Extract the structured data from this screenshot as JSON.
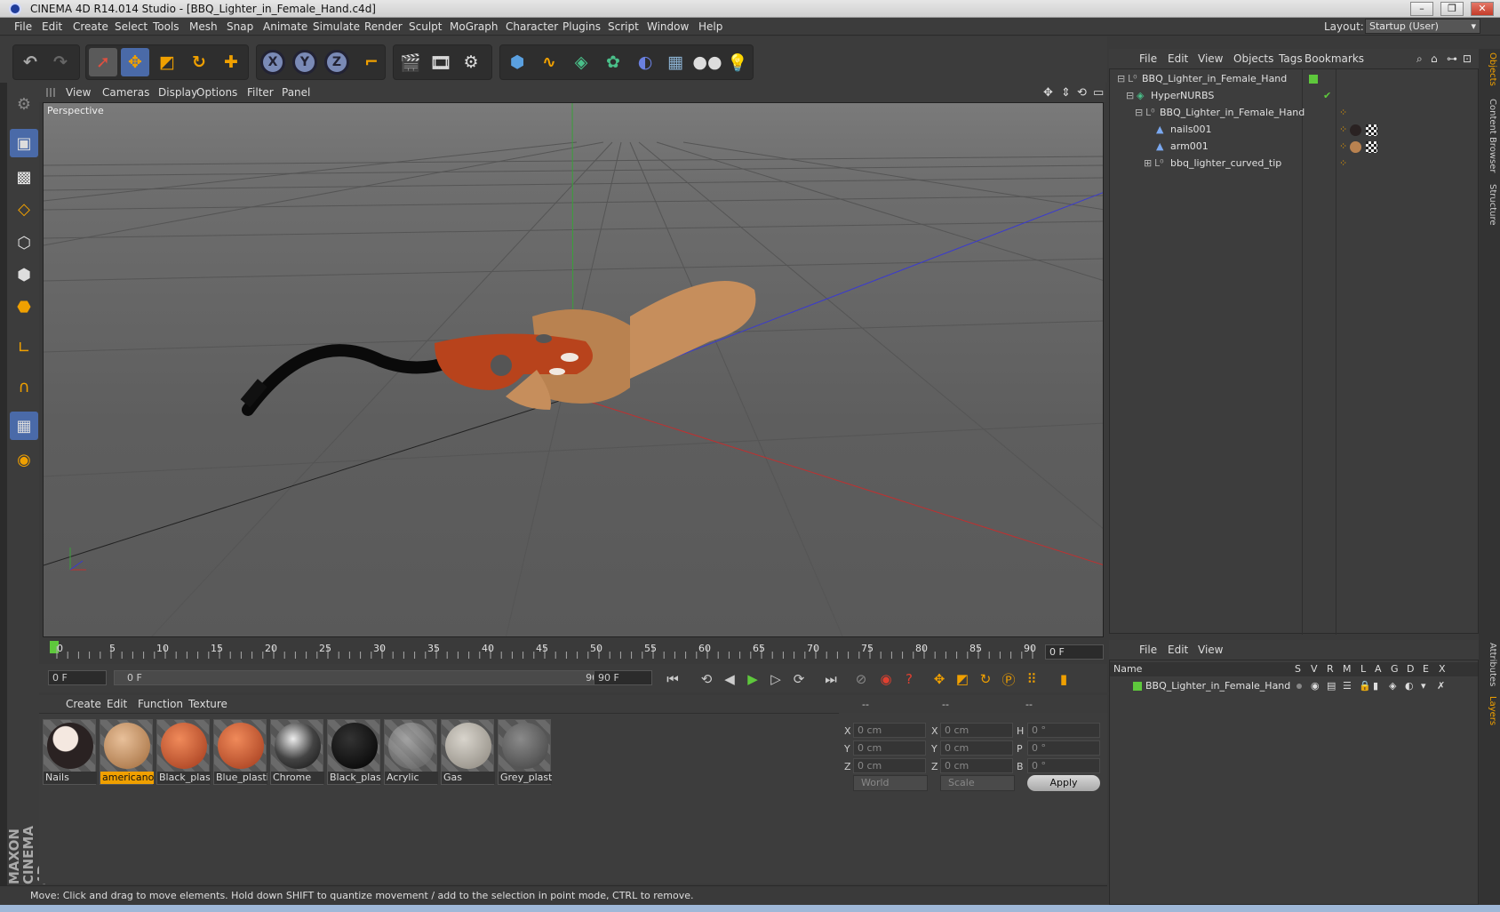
{
  "window": {
    "title": "CINEMA 4D R14.014 Studio - [BBQ_Lighter_in_Female_Hand.c4d]"
  },
  "menubar": {
    "items": [
      "File",
      "Edit",
      "Create",
      "Select",
      "Tools",
      "Mesh",
      "Snap",
      "Animate",
      "Simulate",
      "Render",
      "Sculpt",
      "MoGraph",
      "Character",
      "Plugins",
      "Script",
      "Window",
      "Help"
    ],
    "layout_label": "Layout:",
    "layout_value": "Startup (User)"
  },
  "viewport": {
    "menu": [
      "View",
      "Cameras",
      "Display",
      "Options",
      "Filter",
      "Panel"
    ],
    "label": "Perspective"
  },
  "timeline": {
    "ticks": [
      "0",
      "5",
      "10",
      "15",
      "20",
      "25",
      "30",
      "35",
      "40",
      "45",
      "50",
      "55",
      "60",
      "65",
      "70",
      "75",
      "80",
      "85",
      "90"
    ],
    "current_frame": "0 F",
    "start_field": "0 F",
    "range_start": "0 F",
    "range_end": "90 F",
    "end_field": "90 F"
  },
  "materials": {
    "menu": [
      "Create",
      "Edit",
      "Function",
      "Texture"
    ],
    "items": [
      {
        "name": "Nails",
        "color": "#2a2222"
      },
      {
        "name": "americanoi",
        "color": "#c99a6a",
        "selected": true
      },
      {
        "name": "Black_plast",
        "color": "#c9502a"
      },
      {
        "name": "Blue_plasti",
        "color": "#c9502a"
      },
      {
        "name": "Chrome",
        "color": "#6a6a6a"
      },
      {
        "name": "Black_plast",
        "color": "#080808"
      },
      {
        "name": "Acrylic",
        "color": "#7a7a7a"
      },
      {
        "name": "Gas",
        "color": "#a9a49a"
      },
      {
        "name": "Grey_plasti",
        "color": "#5e5e5e"
      }
    ]
  },
  "coordinates": {
    "header": [
      "--",
      "--",
      "--"
    ],
    "rows": [
      {
        "l1": "X",
        "v1": "0 cm",
        "l2": "X",
        "v2": "0 cm",
        "l3": "H",
        "v3": "0 °"
      },
      {
        "l1": "Y",
        "v1": "0 cm",
        "l2": "Y",
        "v2": "0 cm",
        "l3": "P",
        "v3": "0 °"
      },
      {
        "l1": "Z",
        "v1": "0 cm",
        "l2": "Z",
        "v2": "0 cm",
        "l3": "B",
        "v3": "0 °"
      }
    ],
    "space": "World",
    "mode": "Scale",
    "apply": "Apply"
  },
  "objects": {
    "menu": [
      "File",
      "Edit",
      "View",
      "Objects",
      "Tags",
      "Bookmarks"
    ],
    "rows": [
      {
        "name": "BBQ_Lighter_in_Female_Hand",
        "indent": 0
      },
      {
        "name": "HyperNURBS",
        "indent": 1
      },
      {
        "name": "BBQ_Lighter_in_Female_Hand",
        "indent": 2
      },
      {
        "name": "nails001",
        "indent": 3
      },
      {
        "name": "arm001",
        "indent": 3
      },
      {
        "name": "bbq_lighter_curved_tip",
        "indent": 2
      }
    ]
  },
  "layers": {
    "menu": [
      "File",
      "Edit",
      "View"
    ],
    "columns": [
      "Name",
      "S",
      "V",
      "R",
      "M",
      "L",
      "A",
      "G",
      "D",
      "E",
      "X"
    ],
    "rows": [
      {
        "name": "BBQ_Lighter_in_Female_Hand",
        "color": "#5ec83c"
      }
    ]
  },
  "right_tabs": [
    "Objects",
    "Content Browser",
    "Structure",
    "Attributes",
    "Layers"
  ],
  "status": {
    "text": "Move: Click and drag to move elements. Hold down SHIFT to quantize movement / add to the selection in point mode, CTRL to remove."
  },
  "branding": {
    "text": "MAXON CINEMA 4D"
  },
  "colors": {
    "accent": "#f0a000",
    "active_tool": "#4a6aa8"
  }
}
